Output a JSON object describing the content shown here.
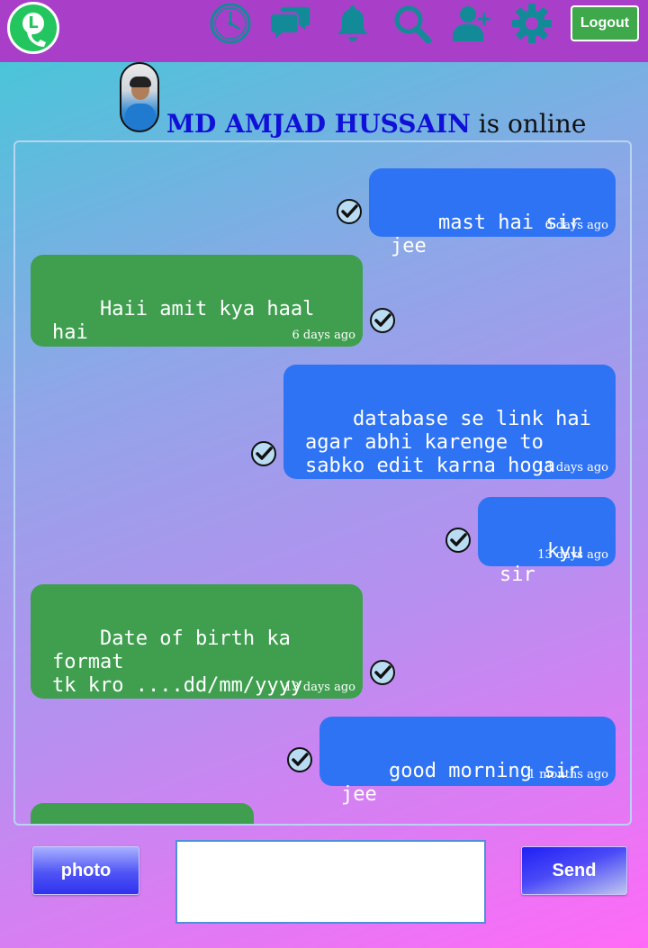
{
  "header": {
    "logo_letter": "L",
    "logout_label": "Logout",
    "icons": [
      "clock-icon",
      "chat-bubbles-icon",
      "bell-icon",
      "search-icon",
      "add-user-icon",
      "gear-icon"
    ],
    "bar_color": "#a93fc9",
    "icon_color": "#138a98"
  },
  "contact": {
    "name": "MD AMJAD HUSSAIN",
    "status": "is online"
  },
  "messages": [
    {
      "direction": "sent",
      "text": "mast hai sir jee",
      "time": "6 days ago",
      "read": true
    },
    {
      "direction": "received",
      "text": "Haii amit kya haal hai",
      "time": "6 days ago",
      "read": true
    },
    {
      "direction": "sent",
      "text": "database se link hai\nagar abhi karenge to\nsabko edit karna hoga",
      "time": "13 days ago",
      "read": true
    },
    {
      "direction": "sent",
      "text": "kyu sir",
      "time": "13 days ago",
      "read": true
    },
    {
      "direction": "received",
      "text": "Date of birth ka format\ntk kro ....dd/mm/yyyy",
      "time": "13 days ago",
      "read": true
    },
    {
      "direction": "sent",
      "text": "good morning sir jee",
      "time": "1 months ago",
      "read": true
    },
    {
      "direction": "received",
      "text": "",
      "time": "",
      "read": false
    }
  ],
  "composer": {
    "photo_label": "photo",
    "send_label": "Send",
    "input_value": ""
  },
  "colors": {
    "sent_bubble": "#2f73f5",
    "received_bubble": "#3f9f4f",
    "name_color": "#1010d8"
  }
}
